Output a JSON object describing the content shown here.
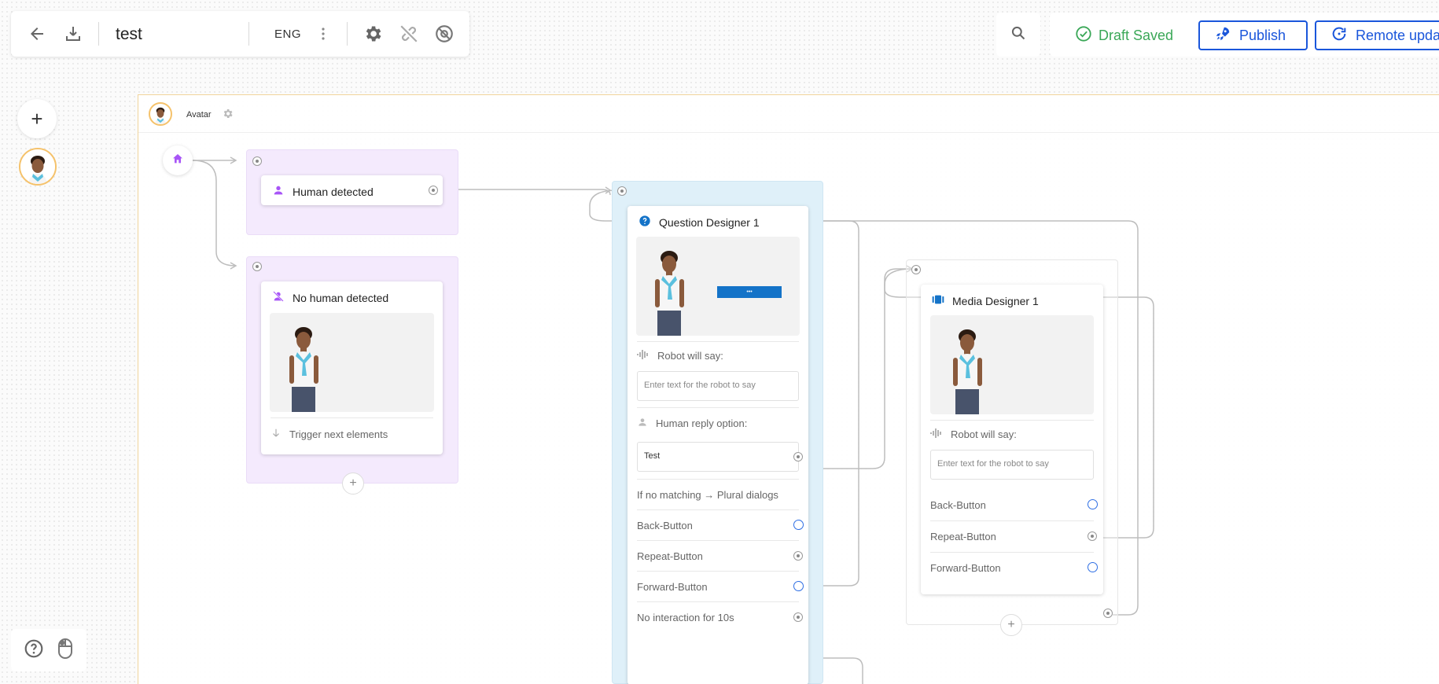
{
  "toolbar": {
    "doc_title": "test",
    "language": "ENG",
    "draft_status": "Draft Saved",
    "publish_label": "Publish",
    "remote_update_label": "Remote upda"
  },
  "canvas": {
    "title": "Avatar"
  },
  "nodes": {
    "human_detected": {
      "title": "Human detected"
    },
    "no_human_detected": {
      "title": "No human detected",
      "trigger_label": "Trigger next elements"
    },
    "question_designer": {
      "title": "Question Designer 1",
      "robot_say_label": "Robot will say:",
      "robot_say_placeholder": "Enter text for the robot to say",
      "human_reply_label": "Human reply option:",
      "reply_value": "Test",
      "no_match_label": "If no matching → Plural dialogs",
      "back_label": "Back-Button",
      "repeat_label": "Repeat-Button",
      "forward_label": "Forward-Button",
      "no_interaction_label": "No interaction for 10s",
      "preview_button_text": "•••"
    },
    "media_designer": {
      "title": "Media Designer 1",
      "robot_say_label": "Robot will say:",
      "robot_say_placeholder": "Enter text for the robot to say",
      "back_label": "Back-Button",
      "repeat_label": "Repeat-Button",
      "forward_label": "Forward-Button"
    }
  },
  "colors": {
    "accent_blue": "#1a56db",
    "draft_green": "#3aa757",
    "purple_icon": "#a855f7",
    "question_icon": "#1473c8",
    "group_purple": "#f4eafd",
    "group_blue": "#dff0f9"
  },
  "icons": [
    "back-arrow-icon",
    "download-icon",
    "more-vert-icon",
    "gear-icon",
    "link-off-icon",
    "no-eye-icon",
    "search-icon",
    "check-circle-icon",
    "rocket-icon",
    "refresh-icon",
    "plus-icon",
    "help-icon",
    "mouse-icon",
    "home-icon",
    "person-icon",
    "person-off-icon",
    "question-icon",
    "media-icon",
    "audio-wave-icon",
    "arrow-down-icon"
  ]
}
